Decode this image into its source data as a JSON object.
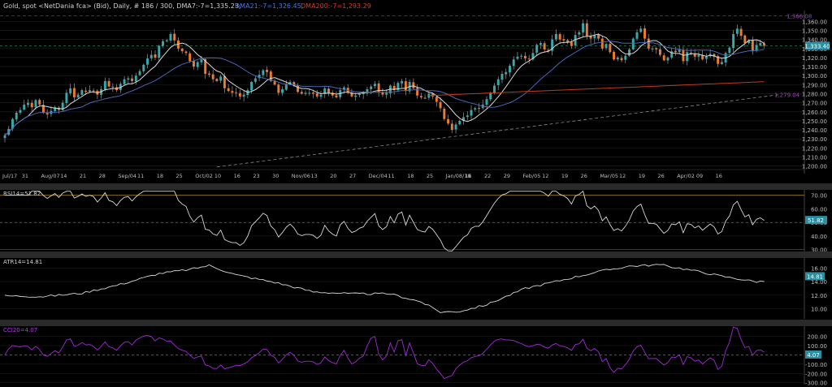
{
  "header": {
    "title": "Gold, spot <NetDania fca> (Bid), Daily, # 186 / 300, DMA7:-7=1,335.23,",
    "dma21": "DMA21:-7=1,326.45,",
    "dma200": "DMA200:-7=1,293.29"
  },
  "colors": {
    "background": "#000000",
    "grid": "#232323",
    "up": "#3aa7a8",
    "down": "#ee7a2c",
    "dma7": "#d8d8d8",
    "dma21": "#4a67b8",
    "dma200": "#c03a1c",
    "trendline": "#8a8a8a",
    "rsi": "#d8d8d8",
    "atr": "#d8d8d8",
    "cci": "#a22ad6",
    "price_tag": "#2a8ea0"
  },
  "chart_data": [
    {
      "type": "candlestick",
      "name": "Gold, spot",
      "yticks": [
        1200,
        1210,
        1220,
        1230,
        1240,
        1250,
        1260,
        1270,
        1280,
        1290,
        1300,
        1310,
        1320,
        1330,
        1340,
        1350,
        1360
      ],
      "ytick_labels": [
        "1,200.00",
        "1,210.00",
        "1,220.00",
        "1,230.00",
        "1,240.00",
        "1,250.00",
        "1,260.00",
        "1,270.00",
        "1,280.00",
        "1,290.00",
        "1,300.00",
        "1,310.00",
        "1,320.00",
        "1,330.00",
        "1,340.00",
        "1,350.00",
        "1,360.00"
      ],
      "ylim": [
        1197,
        1372
      ],
      "x_labels": [
        "Jul/17",
        "31",
        "Aug/07",
        "14",
        "21",
        "28",
        "Sep/04",
        "11",
        "18",
        "25",
        "Oct/02",
        "10",
        "16",
        "23",
        "30",
        "Nov/06",
        "13",
        "20",
        "27",
        "Dec/04",
        "11",
        "18",
        "25",
        "Jan/08/18",
        "16",
        "22",
        "29",
        "Feb/05",
        "12",
        "19",
        "26",
        "Mar/05",
        "12",
        "19",
        "26",
        "Apr/02",
        "09",
        "16"
      ],
      "current_price_label": "1,333.40",
      "high_label": "1,366.08",
      "trend_label": "1,279.04",
      "closes": [
        1234,
        1241,
        1252,
        1259,
        1262,
        1268,
        1270,
        1265,
        1273,
        1268,
        1259,
        1257,
        1261,
        1265,
        1262,
        1270,
        1281,
        1286,
        1276,
        1279,
        1284,
        1282,
        1284,
        1283,
        1279,
        1285,
        1294,
        1288,
        1287,
        1284,
        1291,
        1296,
        1297,
        1294,
        1300,
        1305,
        1312,
        1319,
        1323,
        1320,
        1333,
        1338,
        1339,
        1346,
        1339,
        1330,
        1327,
        1325,
        1316,
        1310,
        1315,
        1318,
        1302,
        1301,
        1296,
        1294,
        1299,
        1286,
        1283,
        1281,
        1281,
        1277,
        1279,
        1284,
        1293,
        1297,
        1301,
        1306,
        1304,
        1294,
        1290,
        1281,
        1285,
        1290,
        1293,
        1289,
        1282,
        1280,
        1281,
        1281,
        1280,
        1277,
        1279,
        1286,
        1281,
        1278,
        1276,
        1284,
        1287,
        1281,
        1277,
        1278,
        1280,
        1281,
        1285,
        1288,
        1291,
        1282,
        1279,
        1281,
        1289,
        1284,
        1292,
        1294,
        1283,
        1293,
        1286,
        1278,
        1276,
        1275,
        1280,
        1277,
        1271,
        1264,
        1252,
        1247,
        1240,
        1246,
        1250,
        1254,
        1256,
        1262,
        1264,
        1264,
        1268,
        1274,
        1281,
        1289,
        1296,
        1302,
        1304,
        1311,
        1318,
        1321,
        1322,
        1319,
        1318,
        1325,
        1334,
        1336,
        1329,
        1327,
        1340,
        1346,
        1340,
        1339,
        1337,
        1333,
        1345,
        1348,
        1358,
        1344,
        1341,
        1345,
        1341,
        1330,
        1335,
        1326,
        1318,
        1320,
        1317,
        1322,
        1329,
        1341,
        1348,
        1352,
        1341,
        1330,
        1330,
        1329,
        1323,
        1317,
        1320,
        1327,
        1326,
        1329,
        1316,
        1326,
        1325,
        1321,
        1323,
        1318,
        1321,
        1324,
        1321,
        1313,
        1315,
        1325,
        1331,
        1346,
        1352,
        1344,
        1336,
        1339,
        1327,
        1334,
        1336,
        1333
      ],
      "series_names": [
        "DMA7",
        "DMA21",
        "DMA200"
      ]
    },
    {
      "type": "line",
      "name": "RSI14",
      "label": "RSI14=51.82",
      "value_label": "51.82",
      "yticks": [
        30,
        40,
        50,
        60,
        70
      ],
      "ytick_labels": [
        "30.00",
        "40.00",
        "50.00",
        "60.00",
        "70.00"
      ],
      "ylim": [
        28,
        74
      ],
      "levels": [
        70,
        50,
        30
      ]
    },
    {
      "type": "line",
      "name": "ATR14",
      "label": "ATR14=14.81",
      "value_label": "14.81",
      "yticks": [
        10,
        12,
        14,
        16
      ],
      "ytick_labels": [
        "10.00",
        "12.00",
        "14.00",
        "16.00"
      ],
      "ylim": [
        8.5,
        17.5
      ],
      "anchors": [
        [
          0,
          11.9
        ],
        [
          10,
          11.8
        ],
        [
          20,
          12.3
        ],
        [
          30,
          13.6
        ],
        [
          40,
          15.2
        ],
        [
          48,
          15.8
        ],
        [
          53,
          16.4
        ],
        [
          60,
          15.0
        ],
        [
          70,
          13.9
        ],
        [
          80,
          12.5
        ],
        [
          90,
          12.2
        ],
        [
          100,
          12.2
        ],
        [
          108,
          11.0
        ],
        [
          113,
          9.5
        ],
        [
          118,
          9.6
        ],
        [
          125,
          10.6
        ],
        [
          135,
          13.0
        ],
        [
          145,
          14.3
        ],
        [
          155,
          15.6
        ],
        [
          162,
          16.3
        ],
        [
          170,
          16.5
        ],
        [
          180,
          15.5
        ],
        [
          186,
          14.8
        ],
        [
          195,
          14.0
        ],
        [
          205,
          14.4
        ],
        [
          213,
          14.6
        ],
        [
          218,
          14.8
        ]
      ]
    },
    {
      "type": "line",
      "name": "CCI20",
      "label": "CCI20=4.07",
      "value_label": "4.07",
      "yticks": [
        -300,
        -200,
        -100,
        100,
        200
      ],
      "ytick_labels": [
        "-300.00",
        "-200.00",
        "-100.00",
        "100.00",
        "200.00"
      ],
      "ylim": [
        -320,
        310
      ],
      "levels": [
        0
      ]
    }
  ]
}
